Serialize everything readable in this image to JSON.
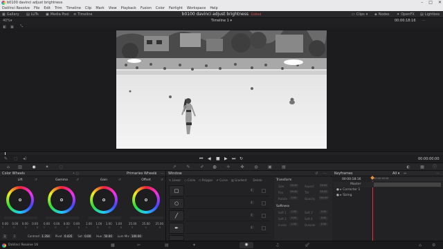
{
  "window": {
    "title": "b0100 davinci adjust brightness",
    "controls": [
      "–",
      "□",
      "✕"
    ]
  },
  "menu": [
    "DaVinci Resolve",
    "File",
    "Edit",
    "Trim",
    "Timeline",
    "Clip",
    "Mark",
    "View",
    "Playback",
    "Fusion",
    "Color",
    "Fairlight",
    "Workspace",
    "Help"
  ],
  "pagebar": {
    "left_items": [
      "Gallery",
      "LUTs",
      "Media Pool",
      "Timeline"
    ],
    "project": "b0100 davinci adjust brightness",
    "edited": "Edited",
    "right_items": [
      "Clips",
      "Nodes",
      "OpenFX",
      "Lightbox"
    ]
  },
  "viewer": {
    "zoom": "40%",
    "timeline_name": "Timeline 1",
    "timecode_top": "00:00:18:16",
    "timecode_right": "00:00:00:00"
  },
  "colorwheels": {
    "title": "Color Wheels",
    "mode": "Primaries Wheels",
    "wheels": [
      {
        "label": "Lift",
        "values": [
          "0.00",
          "0.00",
          "0.00",
          "0.00"
        ],
        "keys": [
          "Y",
          "R",
          "G",
          "B"
        ]
      },
      {
        "label": "Gamma",
        "values": [
          "0.00",
          "0.00",
          "0.00",
          "0.00"
        ],
        "keys": [
          "Y",
          "R",
          "G",
          "B"
        ]
      },
      {
        "label": "Gain",
        "values": [
          "1.00",
          "1.00",
          "1.00",
          "1.00"
        ],
        "keys": [
          "Y",
          "R",
          "G",
          "B"
        ]
      },
      {
        "label": "Offset",
        "values": [
          "25.00",
          "25.00",
          "25.00",
          "25.00"
        ],
        "keys": [
          "R",
          "G",
          "B"
        ]
      }
    ],
    "bottom": [
      {
        "label": "Contrast",
        "value": "1.354"
      },
      {
        "label": "Pivot",
        "value": "0.435"
      },
      {
        "label": "Sat",
        "value": "0.00"
      },
      {
        "label": "Hue",
        "value": "50.00"
      },
      {
        "label": "Lum Mix",
        "value": "100.00"
      }
    ],
    "pages": [
      "1",
      "2"
    ]
  },
  "window_panel": {
    "title": "Window",
    "tools": [
      "Linear",
      "Circle",
      "Polygon",
      "Curve",
      "Gradient",
      "Delete"
    ],
    "transform_title": "Transform",
    "transform_fields": [
      "Size",
      "Aspect",
      "Pan",
      "Tilt",
      "Rotate",
      "Opacity"
    ],
    "transform_values": [
      "50.00",
      "50.00",
      "50.00",
      "50.00",
      "0.00",
      "100.00"
    ],
    "softness_title": "Softness",
    "softness_fields": [
      "Soft 1",
      "Soft 2",
      "Soft 3",
      "Soft 4",
      "Inside",
      "Outside"
    ],
    "softness_values": [
      "2.50",
      "0.00",
      "0.00",
      "0.00",
      "2.50",
      "2.50"
    ]
  },
  "keyframes": {
    "title": "Keyframes",
    "filter": "All",
    "timecode": "00:00:18:16",
    "ruler": "00:00:18:16",
    "rows": [
      "Master",
      "Corrector 1",
      "Sizing"
    ]
  },
  "status": {
    "app": "DaVinci Resolve 16"
  },
  "colors": {
    "accent": "#e55a5a",
    "playhead": "#e33",
    "keyframe": "#e8923a"
  }
}
